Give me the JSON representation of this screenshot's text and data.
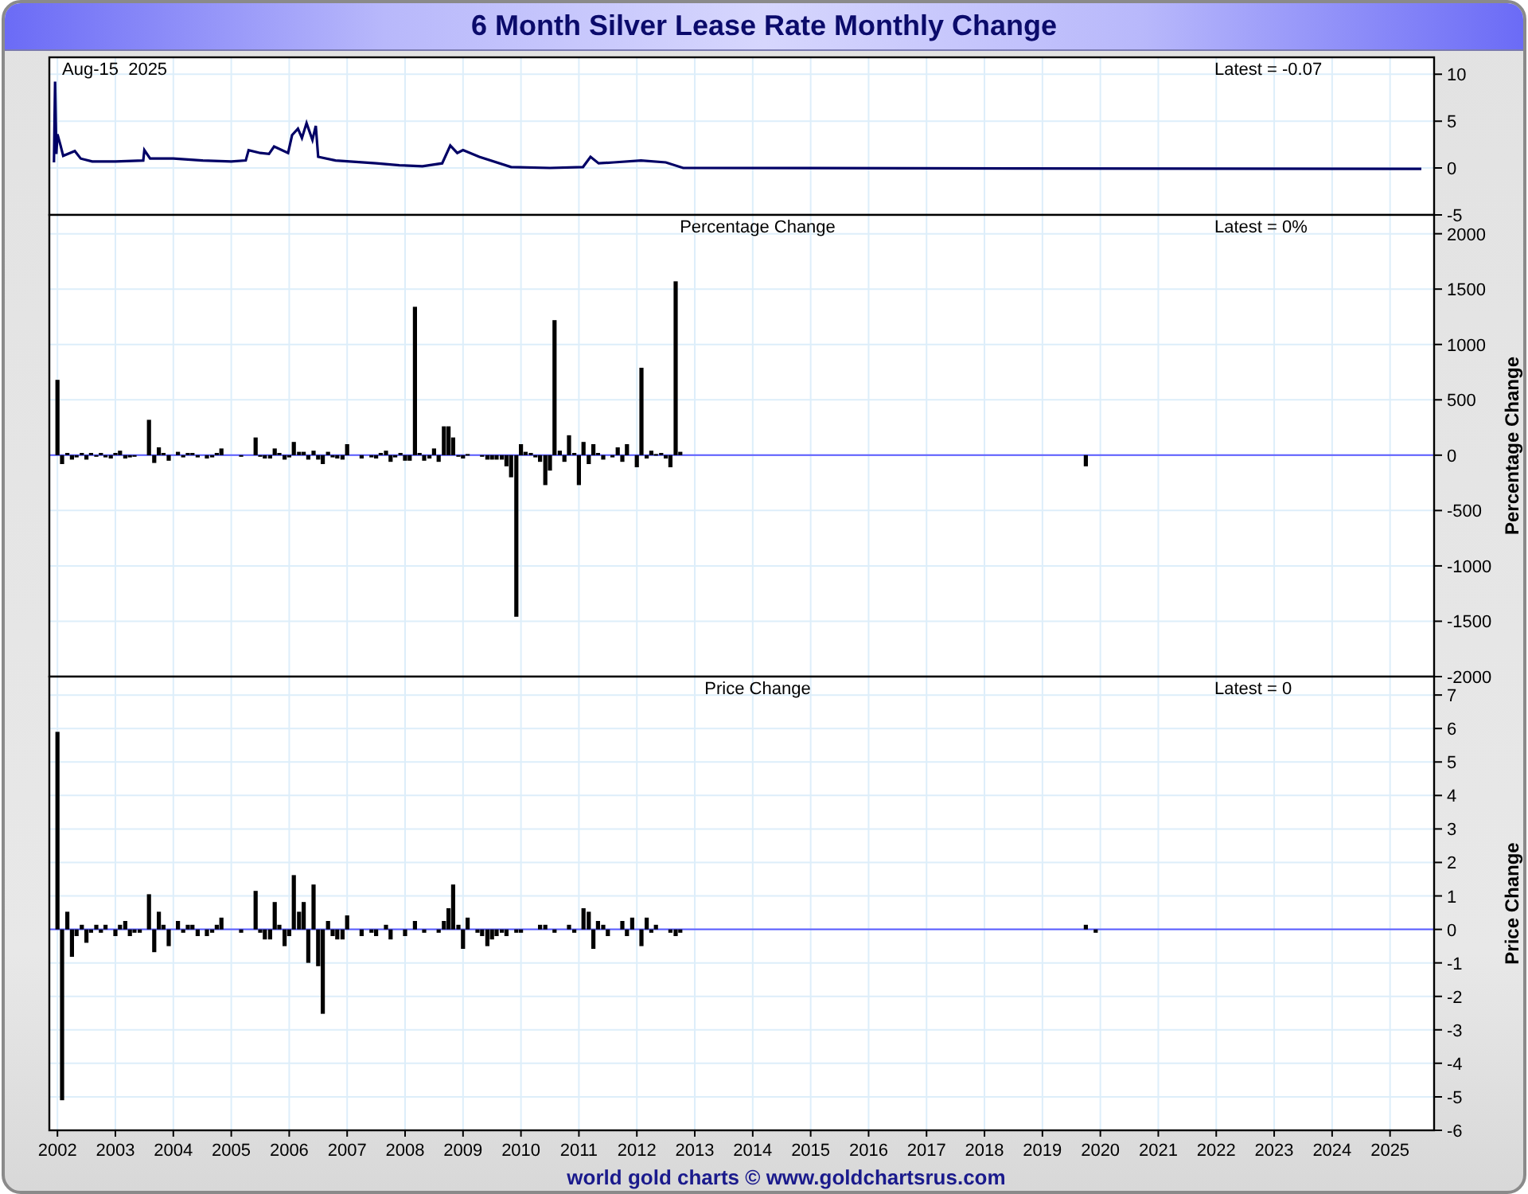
{
  "title": "6 Month Silver Lease Rate Monthly Change",
  "panels": [
    {
      "chart_data": {
        "type": "line",
        "grid": true,
        "xlim": [
          2001.86,
          2025.76
        ],
        "ylim": [
          -5,
          11.8
        ],
        "yticks": [
          10,
          5,
          0,
          -5
        ],
        "annotations": [
          "Aug-15  2025",
          "Latest = -0.07"
        ],
        "x": [
          2001.94,
          2001.96,
          2001.98,
          2002.0,
          2002.05,
          2002.1,
          2002.3,
          2002.4,
          2002.6,
          2003.0,
          2003.48,
          2003.5,
          2003.6,
          2004.0,
          2004.5,
          2005.0,
          2005.25,
          2005.3,
          2005.5,
          2005.65,
          2005.74,
          2005.98,
          2006.05,
          2006.15,
          2006.22,
          2006.3,
          2006.4,
          2006.46,
          2006.5,
          2006.8,
          2007.5,
          2007.9,
          2008.3,
          2008.64,
          2008.78,
          2008.9,
          2009.0,
          2009.28,
          2009.83,
          2010.5,
          2011.07,
          2011.2,
          2011.34,
          2011.6,
          2012.07,
          2012.5,
          2012.8,
          2025.54
        ],
        "values": [
          0.6,
          9.2,
          1.5,
          3.6,
          2.5,
          1.3,
          1.8,
          1.0,
          0.7,
          0.7,
          0.8,
          1.9,
          1.0,
          1.0,
          0.8,
          0.7,
          0.8,
          1.9,
          1.6,
          1.5,
          2.3,
          1.6,
          3.5,
          4.2,
          3.2,
          4.8,
          3.0,
          4.5,
          1.2,
          0.8,
          0.5,
          0.3,
          0.2,
          0.5,
          2.4,
          1.6,
          1.9,
          1.2,
          0.1,
          0.0,
          0.1,
          1.2,
          0.5,
          0.6,
          0.8,
          0.6,
          0.0,
          -0.1
        ]
      }
    },
    {
      "chart_data": {
        "type": "bar",
        "title": "Percentage Change",
        "ylabel": "Percentage Change",
        "xlim": [
          2001.86,
          2025.76
        ],
        "grid": true,
        "ref_lines": [
          {
            "axis": "y",
            "value": 0,
            "color": "#5a5aff"
          }
        ],
        "ylim": [
          -2000,
          2170
        ],
        "yticks": [
          2000,
          1500,
          1000,
          500,
          0,
          -500,
          -1000,
          -1500,
          -2000
        ],
        "annotations": [
          "Latest = 0%"
        ],
        "x": [
          2002.0,
          2002.08,
          2002.17,
          2002.25,
          2002.33,
          2002.42,
          2002.5,
          2002.58,
          2002.67,
          2002.75,
          2002.83,
          2002.92,
          2003.0,
          2003.08,
          2003.17,
          2003.25,
          2003.33,
          2003.58,
          2003.67,
          2003.75,
          2003.83,
          2003.92,
          2004.08,
          2004.17,
          2004.25,
          2004.33,
          2004.42,
          2004.58,
          2004.67,
          2004.75,
          2004.83,
          2005.17,
          2005.42,
          2005.5,
          2005.58,
          2005.67,
          2005.75,
          2005.83,
          2005.92,
          2006.0,
          2006.08,
          2006.17,
          2006.25,
          2006.33,
          2006.42,
          2006.5,
          2006.58,
          2006.67,
          2006.75,
          2006.83,
          2006.92,
          2007.0,
          2007.25,
          2007.42,
          2007.5,
          2007.58,
          2007.67,
          2007.75,
          2007.83,
          2007.92,
          2008.0,
          2008.08,
          2008.17,
          2008.25,
          2008.33,
          2008.42,
          2008.5,
          2008.58,
          2008.67,
          2008.75,
          2008.83,
          2008.92,
          2009.0,
          2009.08,
          2009.33,
          2009.42,
          2009.5,
          2009.58,
          2009.67,
          2009.75,
          2009.83,
          2009.92,
          2010.0,
          2010.08,
          2010.17,
          2010.25,
          2010.33,
          2010.42,
          2010.5,
          2010.58,
          2010.67,
          2010.75,
          2010.83,
          2010.92,
          2011.0,
          2011.08,
          2011.17,
          2011.25,
          2011.33,
          2011.42,
          2011.58,
          2011.67,
          2011.75,
          2011.83,
          2012.0,
          2012.08,
          2012.17,
          2012.25,
          2012.33,
          2012.42,
          2012.5,
          2012.58,
          2012.67,
          2012.75,
          2019.75
        ],
        "values": [
          680,
          -80,
          20,
          -40,
          -20,
          20,
          -40,
          20,
          -10,
          20,
          -20,
          -30,
          20,
          40,
          -30,
          -20,
          -10,
          320,
          -70,
          70,
          20,
          -50,
          30,
          -20,
          20,
          20,
          -20,
          -30,
          -20,
          20,
          60,
          -10,
          160,
          -10,
          -30,
          -30,
          60,
          20,
          -40,
          -20,
          120,
          30,
          30,
          -40,
          40,
          -40,
          -80,
          30,
          -20,
          -30,
          -40,
          100,
          -30,
          -20,
          -30,
          20,
          40,
          -60,
          -20,
          20,
          -50,
          -50,
          1340,
          20,
          -50,
          -30,
          60,
          -60,
          260,
          260,
          160,
          -10,
          -30,
          10,
          -10,
          -40,
          -40,
          -40,
          -40,
          -100,
          -200,
          -1460,
          100,
          30,
          20,
          -20,
          -60,
          -270,
          -140,
          1220,
          40,
          -60,
          180,
          20,
          -270,
          120,
          -80,
          100,
          20,
          -40,
          -20,
          70,
          -60,
          100,
          -110,
          790,
          -30,
          40,
          10,
          20,
          -30,
          -110,
          1570,
          30,
          -100
        ]
      }
    },
    {
      "chart_data": {
        "type": "bar",
        "title": "Price Change",
        "ylabel": "Price Change",
        "xlim": [
          2001.86,
          2025.76
        ],
        "grid": true,
        "ref_lines": [
          {
            "axis": "y",
            "value": 0,
            "color": "#5a5aff"
          }
        ],
        "ylim": [
          -6,
          7.55
        ],
        "yticks": [
          7,
          6,
          5,
          4,
          3,
          2,
          1,
          0,
          -1,
          -2,
          -3,
          -4,
          -5,
          -6
        ],
        "xticks": [
          2002,
          2003,
          2004,
          2005,
          2006,
          2007,
          2008,
          2009,
          2010,
          2011,
          2012,
          2013,
          2014,
          2015,
          2016,
          2017,
          2018,
          2019,
          2020,
          2021,
          2022,
          2023,
          2024,
          2025
        ],
        "annotations": [
          "Latest = 0"
        ],
        "x": [
          2002.0,
          2002.08,
          2002.17,
          2002.25,
          2002.33,
          2002.42,
          2002.5,
          2002.58,
          2002.67,
          2002.75,
          2002.83,
          2003.0,
          2003.08,
          2003.17,
          2003.25,
          2003.33,
          2003.42,
          2003.58,
          2003.67,
          2003.75,
          2003.83,
          2003.92,
          2004.08,
          2004.17,
          2004.25,
          2004.33,
          2004.42,
          2004.58,
          2004.67,
          2004.75,
          2004.83,
          2005.17,
          2005.42,
          2005.5,
          2005.58,
          2005.67,
          2005.75,
          2005.83,
          2005.92,
          2006.0,
          2006.08,
          2006.17,
          2006.25,
          2006.33,
          2006.42,
          2006.5,
          2006.58,
          2006.67,
          2006.75,
          2006.83,
          2006.92,
          2007.0,
          2007.25,
          2007.42,
          2007.5,
          2007.67,
          2007.75,
          2008.0,
          2008.17,
          2008.33,
          2008.58,
          2008.67,
          2008.75,
          2008.83,
          2008.92,
          2009.0,
          2009.08,
          2009.25,
          2009.33,
          2009.42,
          2009.5,
          2009.58,
          2009.67,
          2009.75,
          2009.92,
          2010.0,
          2010.33,
          2010.42,
          2010.58,
          2010.83,
          2010.92,
          2011.08,
          2011.17,
          2011.25,
          2011.33,
          2011.42,
          2011.5,
          2011.75,
          2011.83,
          2011.92,
          2012.08,
          2012.17,
          2012.25,
          2012.33,
          2012.58,
          2012.67,
          2012.75,
          2019.75,
          2019.92
        ],
        "values": [
          5.9,
          -5.1,
          0.53,
          -0.82,
          -0.2,
          0.14,
          -0.4,
          -0.1,
          0.14,
          -0.1,
          0.14,
          -0.2,
          0.14,
          0.25,
          -0.2,
          -0.1,
          -0.1,
          1.05,
          -0.68,
          0.53,
          0.14,
          -0.5,
          0.25,
          -0.1,
          0.14,
          0.14,
          -0.2,
          -0.2,
          -0.1,
          0.14,
          0.35,
          -0.1,
          1.15,
          -0.1,
          -0.3,
          -0.3,
          0.82,
          0.14,
          -0.5,
          -0.2,
          1.62,
          0.53,
          0.82,
          -1.0,
          1.34,
          -1.1,
          -2.52,
          0.25,
          -0.2,
          -0.3,
          -0.3,
          0.42,
          -0.2,
          -0.1,
          -0.2,
          0.14,
          -0.3,
          -0.2,
          0.25,
          -0.1,
          -0.1,
          0.25,
          0.63,
          1.34,
          0.14,
          -0.58,
          0.35,
          -0.1,
          -0.2,
          -0.5,
          -0.3,
          -0.2,
          -0.1,
          -0.2,
          -0.1,
          -0.1,
          0.14,
          0.14,
          -0.1,
          0.14,
          -0.1,
          0.63,
          0.53,
          -0.58,
          0.25,
          0.14,
          -0.2,
          0.25,
          -0.2,
          0.35,
          -0.5,
          0.35,
          -0.1,
          0.14,
          -0.1,
          -0.2,
          -0.1,
          0.14,
          -0.1
        ]
      }
    }
  ],
  "footer": "world gold charts © www.goldchartsrus.com"
}
